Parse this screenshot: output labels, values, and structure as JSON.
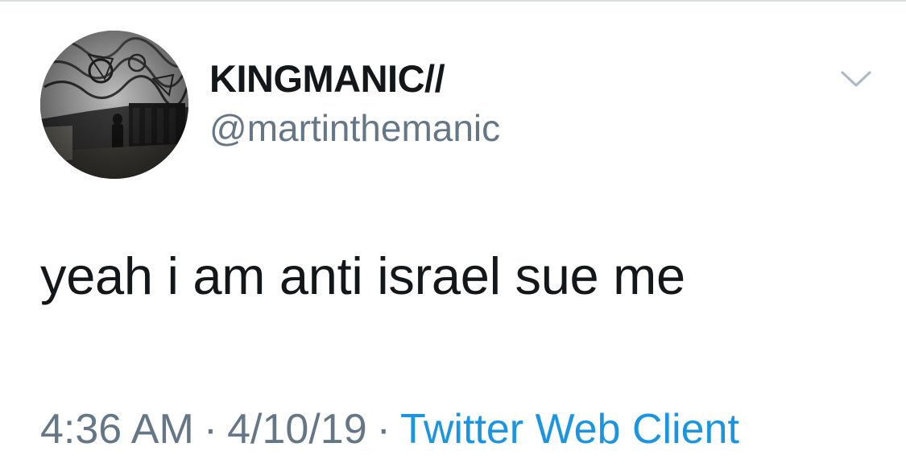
{
  "tweet": {
    "author": {
      "display_name": "KINGMANIC//",
      "handle": "@martinthemanic",
      "avatar_icon": "profile-photo-mural"
    },
    "menu_icon": "chevron-down-icon",
    "text": "yeah i am anti israel sue me",
    "meta": {
      "time": "4:36 AM",
      "date": "4/10/19",
      "separator": "·",
      "source": "Twitter Web Client"
    }
  },
  "colors": {
    "text_primary": "#14171a",
    "text_secondary": "#657786",
    "link": "#1b95e0",
    "caret": "#aab8c2"
  }
}
